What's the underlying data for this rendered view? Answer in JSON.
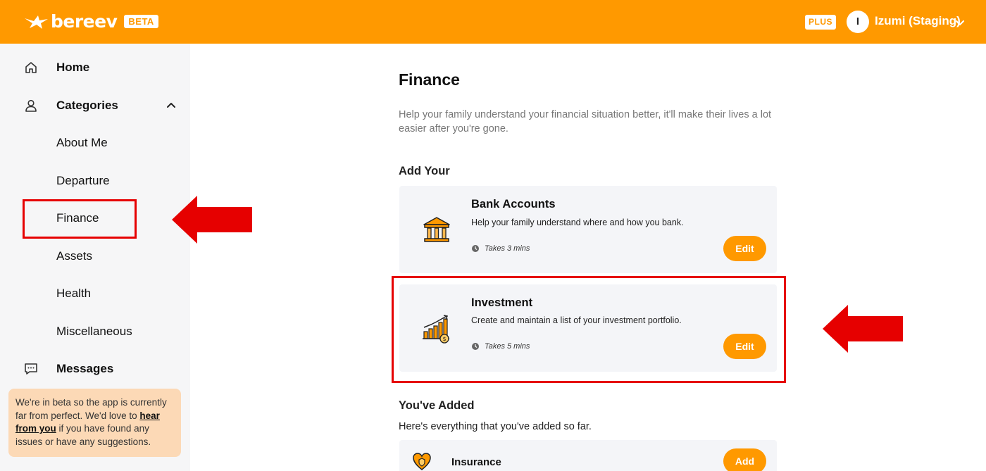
{
  "header": {
    "logo_text": "bereev",
    "beta_badge": "BETA",
    "plus_badge": "PLUS",
    "avatar_initial": "I",
    "user_name": "Izumi (Staging)",
    "brand_color": "#ff9900"
  },
  "sidebar": {
    "home": {
      "label": "Home",
      "icon": "home-icon"
    },
    "categories": {
      "label": "Categories",
      "icon": "person-icon",
      "expanded": true
    },
    "sub_items": [
      {
        "label": "About Me"
      },
      {
        "label": "Departure"
      },
      {
        "label": "Finance",
        "selected": true
      },
      {
        "label": "Assets"
      },
      {
        "label": "Health"
      },
      {
        "label": "Miscellaneous"
      }
    ],
    "messages": {
      "label": "Messages",
      "icon": "chat-icon"
    },
    "beta_note": {
      "text_before": "We're in beta so the app is currently far from perfect. We'd love to ",
      "link": "hear from you",
      "text_after": " if you have found any issues or have any suggestions."
    }
  },
  "main": {
    "title": "Finance",
    "description": "Help your family understand your financial situation better, it'll make their lives a lot easier after you're gone.",
    "add_section_title": "Add Your",
    "cards": [
      {
        "title": "Bank Accounts",
        "description": "Help your family understand where and how you bank.",
        "time": "Takes 3 mins",
        "button": "Edit",
        "icon": "bank-icon"
      },
      {
        "title": "Investment",
        "description": "Create and maintain a list of your investment portfolio.",
        "time": "Takes 5 mins",
        "button": "Edit",
        "icon": "investment-chart-icon"
      }
    ],
    "added_section_title": "You've Added",
    "added_section_sub": "Here's everything that you've added so far.",
    "added_items": [
      {
        "title": "Insurance",
        "button": "Add",
        "icon": "insurance-shield-icon"
      }
    ]
  },
  "annotations": {
    "highlight_color": "#e60000"
  }
}
